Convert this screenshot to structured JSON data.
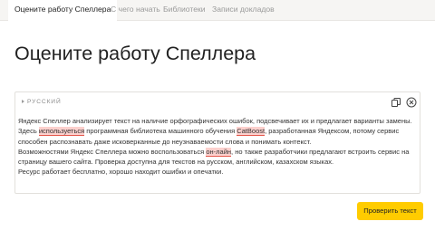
{
  "nav": {
    "tabs": [
      {
        "label": "Оцените работу Спеллера",
        "active": true
      },
      {
        "label": "С чего начать",
        "active": false
      },
      {
        "label": "Библиотеки",
        "active": false
      },
      {
        "label": "Записи докладов",
        "active": false
      }
    ]
  },
  "page_title": "Оцените работу Спеллера",
  "editor": {
    "language": "РУССКИЙ",
    "copy_icon": "copy-icon",
    "clear_icon": "clear-icon",
    "text": {
      "line1": "Яндекс Спеллер анализирует текст на наличие орфографических ошибок, подсвечивает их и предлагает варианты замены.",
      "line2_before_1": "Здесь ",
      "line2_error_1": "используеться",
      "line2_middle": " программная библиотека машинного обучения ",
      "line2_error_2": "CatBoost",
      "line2_after": ", разработанная Яндексом, потому сервис",
      "line3": "способен распознавать даже исковерканные до неузнаваемости слова и понимать контекст.",
      "line4_before": "Возможностями Яндекс Спеллера можно воспользоваться ",
      "line4_error": "он-лайн",
      "line4_after": ", но также разработчики предлагают встроить сервис на",
      "line5": "страницу вашего сайта. Проверка доступна для текстов на русском, английском, казахском языках.",
      "line6": "Ресурс работает бесплатно, хорошо находит ошибки и опечатки."
    }
  },
  "check_button": {
    "label": "Проверить текст"
  },
  "colors": {
    "accent": "#ffcc00",
    "error_highlight": "#fcd0cd",
    "error_underline": "#e55a4e",
    "nav_background": "#f6f5f3"
  }
}
